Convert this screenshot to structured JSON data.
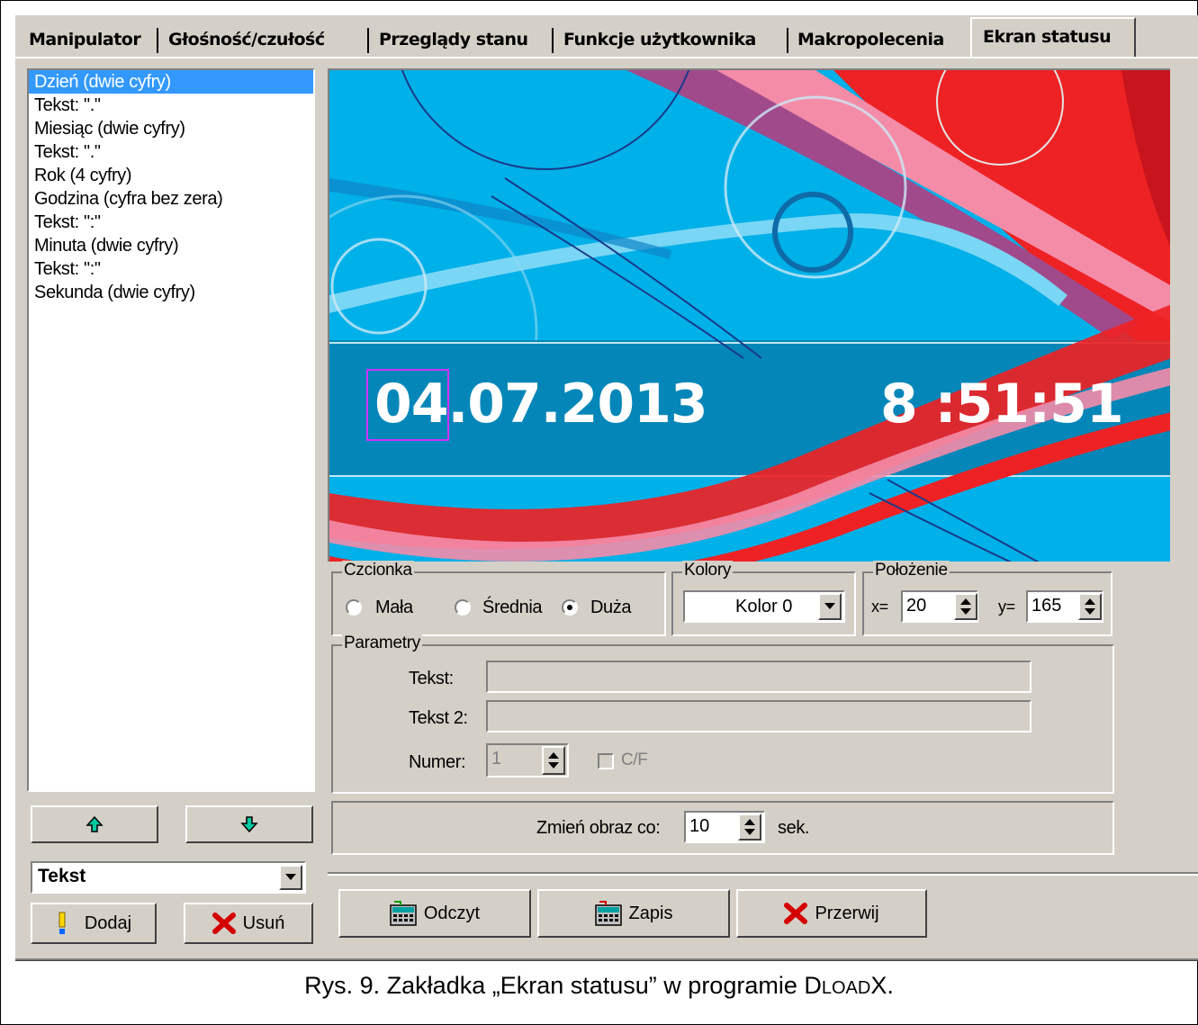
{
  "tabs": [
    {
      "label": "Manipulator",
      "active": false
    },
    {
      "label": "Głośność/czułość",
      "active": false
    },
    {
      "label": "Przeglądy stanu",
      "active": false
    },
    {
      "label": "Funkcje użytkownika",
      "active": false
    },
    {
      "label": "Makropolecenia",
      "active": false
    },
    {
      "label": "Ekran statusu",
      "active": true
    }
  ],
  "element_list": {
    "items": [
      "Dzień (dwie cyfry)",
      "Tekst: \".\"",
      "Miesiąc (dwie cyfry)",
      "Tekst: \".\"",
      "Rok (4 cyfry)",
      "Godzina (cyfra bez zera)",
      "Tekst: \":\"",
      "Minuta (dwie cyfry)",
      "Tekst: \":\"",
      "Sekunda (dwie cyfry)"
    ],
    "selected_index": 0
  },
  "left_controls": {
    "up_icon": "arrow-up-icon",
    "down_icon": "arrow-down-icon",
    "type_select_value": "Tekst",
    "add_label": "Dodaj",
    "remove_label": "Usuń"
  },
  "preview": {
    "date": "04.07.2013",
    "time": "8 :51:51"
  },
  "font_group": {
    "legend": "Czcionka",
    "options": [
      "Mała",
      "Średnia",
      "Duża"
    ],
    "selected": "Duża"
  },
  "colors_group": {
    "legend": "Kolory",
    "value": "Kolor 0"
  },
  "position_group": {
    "legend": "Położenie",
    "x_label": "x=",
    "x_value": "20",
    "y_label": "y=",
    "y_value": "165"
  },
  "params_group": {
    "legend": "Parametry",
    "text_label": "Tekst:",
    "text_value": "",
    "text2_label": "Tekst 2:",
    "text2_value": "",
    "number_label": "Numer:",
    "number_value": "1",
    "cf_label": "C/F"
  },
  "interval": {
    "label": "Zmień obraz co:",
    "value": "10",
    "unit": "sek."
  },
  "bottom_buttons": {
    "read_label": "Odczyt",
    "write_label": "Zapis",
    "abort_label": "Przerwij"
  },
  "caption": {
    "prefix": "Rys. 9. Zakładka „Ekran statusu” w programie D",
    "smallcaps": "LOAD",
    "suffix": "X."
  },
  "colors": {
    "window_bg": "#d4d0c8",
    "selection": "#3399ff",
    "preview_blue": "#00b4ea",
    "preview_red": "#ee1c24"
  }
}
